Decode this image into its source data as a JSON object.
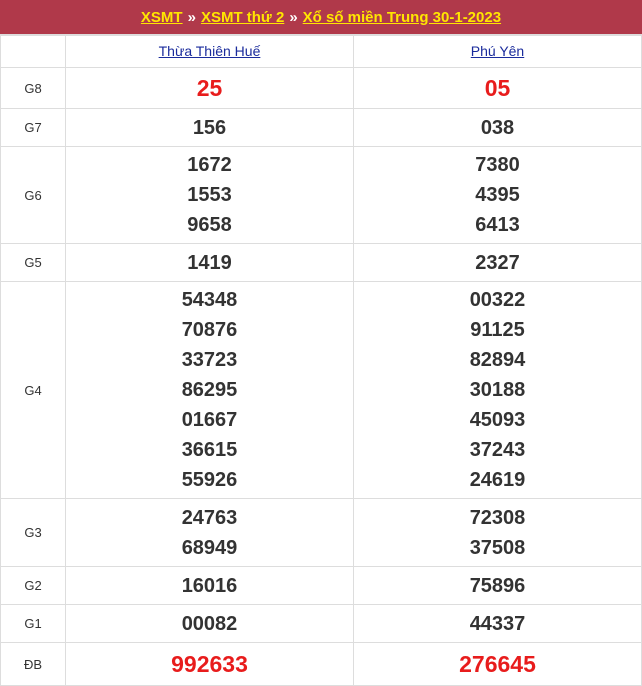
{
  "header": {
    "crumb1": "XSMT",
    "crumb2": "XSMT thứ 2",
    "crumb3": "Xổ số miền Trung 30-1-2023",
    "separator": "»"
  },
  "provinces": [
    "Thừa Thiên Huế",
    "Phú Yên"
  ],
  "prizes": [
    {
      "label": "G8",
      "p1": [
        "25"
      ],
      "p2": [
        "05"
      ]
    },
    {
      "label": "G7",
      "p1": [
        "156"
      ],
      "p2": [
        "038"
      ]
    },
    {
      "label": "G6",
      "p1": [
        "1672",
        "1553",
        "9658"
      ],
      "p2": [
        "7380",
        "4395",
        "6413"
      ]
    },
    {
      "label": "G5",
      "p1": [
        "1419"
      ],
      "p2": [
        "2327"
      ]
    },
    {
      "label": "G4",
      "p1": [
        "54348",
        "70876",
        "33723",
        "86295",
        "01667",
        "36615",
        "55926"
      ],
      "p2": [
        "00322",
        "91125",
        "82894",
        "30188",
        "45093",
        "37243",
        "24619"
      ]
    },
    {
      "label": "G3",
      "p1": [
        "24763",
        "68949"
      ],
      "p2": [
        "72308",
        "37508"
      ]
    },
    {
      "label": "G2",
      "p1": [
        "16016"
      ],
      "p2": [
        "75896"
      ]
    },
    {
      "label": "G1",
      "p1": [
        "00082"
      ],
      "p2": [
        "44337"
      ]
    },
    {
      "label": "ĐB",
      "p1": [
        "992633"
      ],
      "p2": [
        "276645"
      ]
    }
  ],
  "colors": {
    "header_bg": "#b0394a",
    "header_link": "#ffe600",
    "highlight": "#e81c1c",
    "province_link": "#1a2b9c"
  }
}
